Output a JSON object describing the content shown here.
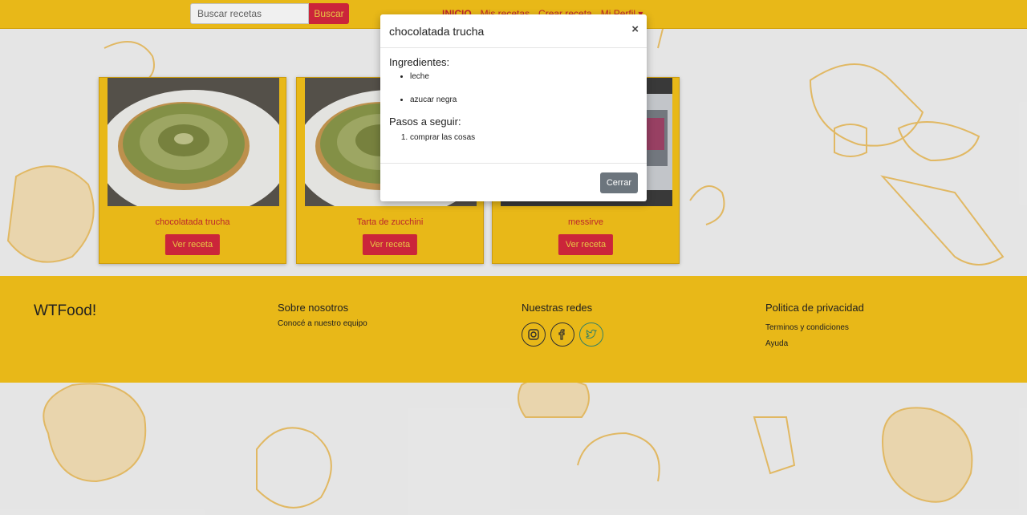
{
  "navbar": {
    "search_placeholder": "Buscar recetas",
    "search_button": "Buscar",
    "links": [
      "INICIO",
      "Mis recetas",
      "Crear receta",
      "Mi Perfil ▾"
    ]
  },
  "cards": [
    {
      "title": "chocolatada trucha",
      "button": "Ver receta"
    },
    {
      "title": "Tarta de zucchini",
      "button": "Ver receta"
    },
    {
      "title": "messirve",
      "button": "Ver receta"
    }
  ],
  "footer": {
    "brand": "WTFood!",
    "about": {
      "heading": "Sobre nosotros",
      "link": "Conocé a nuestro equipo"
    },
    "social": {
      "heading": "Nuestras redes",
      "icons": [
        "instagram-icon",
        "facebook-icon",
        "twitter-icon"
      ]
    },
    "privacy": {
      "heading": "Politica de privacidad",
      "links": [
        "Terminos y condiciones",
        "Ayuda"
      ]
    }
  },
  "modal": {
    "title": "chocolatada trucha",
    "close": "×",
    "ingredients_heading": "Ingredientes:",
    "ingredients": [
      "leche",
      "azucar negra"
    ],
    "steps_heading": "Pasos a seguir:",
    "steps": [
      "comprar las cosas"
    ],
    "close_button": "Cerrar"
  },
  "colors": {
    "primary": "#f7c41a",
    "accent": "#d8283e",
    "link": "#c8282f",
    "secondary": "#6c757d"
  }
}
